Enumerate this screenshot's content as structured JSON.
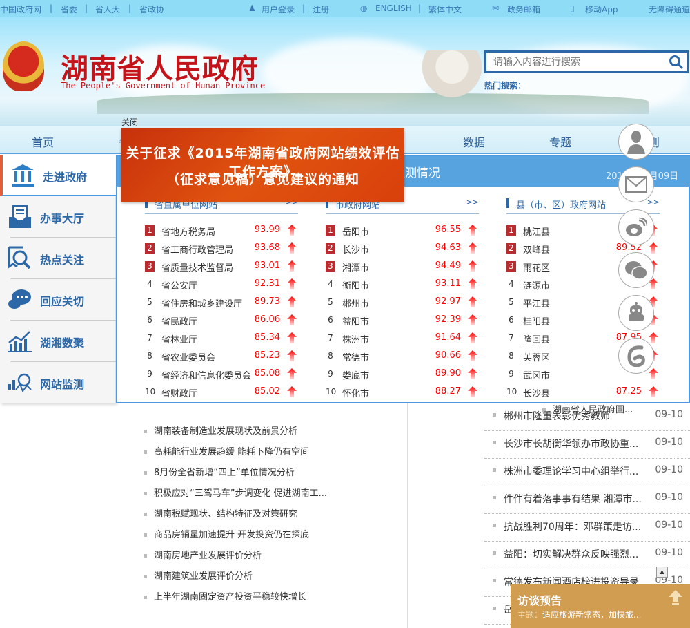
{
  "topbar": {
    "links": [
      "中国政府网",
      "|",
      "省委",
      "|",
      "省人大",
      "|",
      "省政协"
    ],
    "login": "用户登录",
    "sep": "|",
    "register": "注册",
    "english": "ENGLISH",
    "sep2": "|",
    "traditional": "繁体中文",
    "mail": "政务邮箱",
    "app": "移动App",
    "accessible": "无障碍通道"
  },
  "header": {
    "title": "湖南省人民政府",
    "subtitle": "The People's Government of Hunan Province",
    "search_placeholder": "请输入内容进行搜索",
    "hot_search": "热门搜索："
  },
  "nav": {
    "items": [
      "首页",
      "省",
      "数据",
      "专题",
      "则"
    ]
  },
  "sidebar": {
    "items": [
      "走进政府",
      "办事大厅",
      "热点关注",
      "回应关切",
      "湖湘数聚",
      "网站监测"
    ]
  },
  "popup": {
    "close": "关闭",
    "line1": "关于征求《2015年湖南省政府网站绩效评估工作方案》",
    "line2": "（征求意见稿）意见建议的通知"
  },
  "panel": {
    "title": "监测情况",
    "date": "2015年09月09日",
    "columns": [
      {
        "title": "省直属单位网站",
        "more": ">>",
        "rows": [
          [
            "1",
            "省地方税务局",
            "93.99"
          ],
          [
            "2",
            "省工商行政管理局",
            "93.68"
          ],
          [
            "3",
            "省质量技术监督局",
            "93.01"
          ],
          [
            "4",
            "省公安厅",
            "92.31"
          ],
          [
            "5",
            "省住房和城乡建设厅",
            "89.73"
          ],
          [
            "6",
            "省民政厅",
            "86.06"
          ],
          [
            "7",
            "省林业厅",
            "85.34"
          ],
          [
            "8",
            "省农业委员会",
            "85.23"
          ],
          [
            "9",
            "省经济和信息化委员会",
            "85.08"
          ],
          [
            "10",
            "省财政厅",
            "85.02"
          ]
        ]
      },
      {
        "title": "市政府网站",
        "more": ">>",
        "rows": [
          [
            "1",
            "岳阳市",
            "96.55"
          ],
          [
            "2",
            "长沙市",
            "94.63"
          ],
          [
            "3",
            "湘潭市",
            "94.49"
          ],
          [
            "4",
            "衡阳市",
            "93.11"
          ],
          [
            "5",
            "郴州市",
            "92.97"
          ],
          [
            "6",
            "益阳市",
            "92.39"
          ],
          [
            "7",
            "株洲市",
            "91.64"
          ],
          [
            "8",
            "常德市",
            "90.66"
          ],
          [
            "9",
            "娄底市",
            "89.90"
          ],
          [
            "10",
            "怀化市",
            "88.27"
          ]
        ]
      },
      {
        "title": "县（市、区）政府网站",
        "more": ">>",
        "rows": [
          [
            "1",
            "桃江县",
            ""
          ],
          [
            "2",
            "双峰县",
            "89.52"
          ],
          [
            "3",
            "雨花区",
            ""
          ],
          [
            "4",
            "涟源市",
            ""
          ],
          [
            "5",
            "平江县",
            ""
          ],
          [
            "6",
            "桂阳县",
            ""
          ],
          [
            "7",
            "隆回县",
            "87.95"
          ],
          [
            "8",
            "芙蓉区",
            ""
          ],
          [
            "9",
            "武冈市",
            ""
          ],
          [
            "10",
            "长沙县",
            "87.25"
          ]
        ]
      }
    ]
  },
  "news_left": [
    "湖南装备制造业发展现状及前景分析",
    "高耗能行业发展趋缓 能耗下降仍有空间",
    "8月份全省新增“四上”单位情况分析",
    "积极应对“三驾马车”步调变化 促进湖南工...",
    "湖南税赋现状、结构特征及对策研究",
    "商品房销量加速提升 开发投资仍在探底",
    "湖南房地产业发展评价分析",
    "湖南建筑业发展评价分析",
    "上半年湖南固定资产投资平稳较快增长"
  ],
  "news_right_top": "湖南省人民政府国...",
  "news_right": [
    [
      "郴州市隆重表彰优秀教师",
      "09-10"
    ],
    [
      "长沙市长胡衡华领办市政协重...",
      "09-10"
    ],
    [
      "株洲市委理论学习中心组举行...",
      "09-10"
    ],
    [
      "件件有着落事事有结果 湘潭市...",
      "09-10"
    ],
    [
      "抗战胜利70周年：邓群策走访...",
      "09-10"
    ],
    [
      "益阳：切实解决群众反映强烈...",
      "09-10"
    ],
    [
      "常德发布新闻酒店榜进投资导录",
      "09-10"
    ],
    [
      "岳",
      "09-10"
    ]
  ],
  "interview": {
    "title": "访谈预告",
    "label": "主题：",
    "topic": "适应旅游新常态，加快旅..."
  },
  "colors": {
    "accent": "#56a3e0",
    "brand_red": "#c3131b",
    "popup": "#d9400c",
    "interview": "#d19d50"
  }
}
